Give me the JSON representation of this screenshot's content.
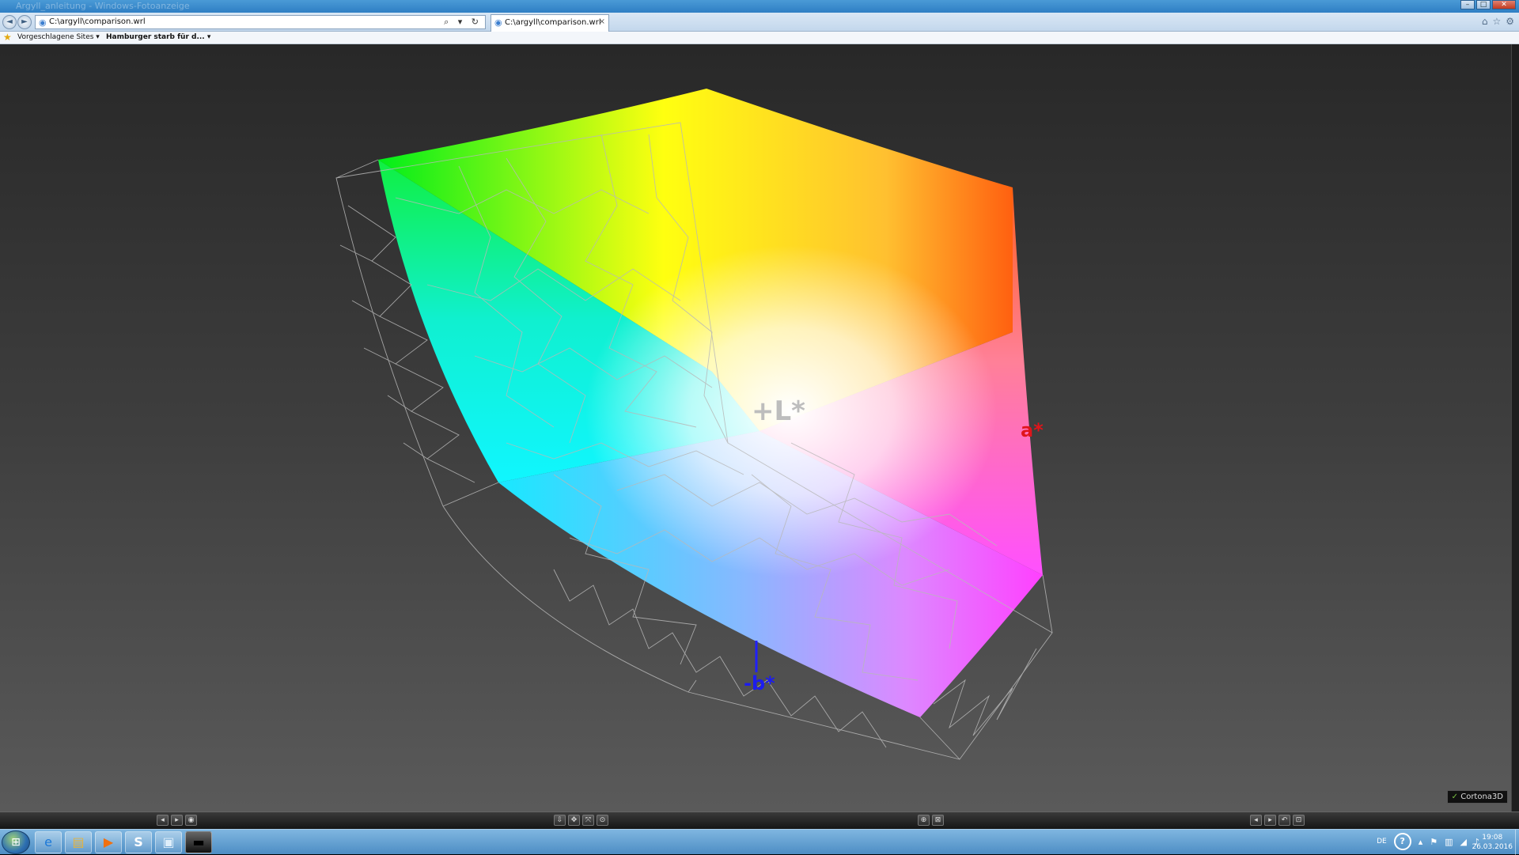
{
  "window": {
    "ghost_title": "Argyll_anleitung - Windows-Fotoanzeige",
    "min": "–",
    "max": "□",
    "close": "✕"
  },
  "nav": {
    "back_icon": "◄",
    "forward_icon": "►",
    "address": "C:\\argyll\\comparison.wrl",
    "address_tools": "⌕ ▾ ↻",
    "tab_label": "C:\\argyll\\comparison.wrl",
    "tab_close": "×",
    "tool_icons": [
      "⌂",
      "☆",
      "⚙"
    ]
  },
  "favorites": {
    "star": "★",
    "suggested_sites": "Vorgeschlagene Sites ▾",
    "news_item": "Hamburger starb für d... ▾"
  },
  "viewer": {
    "axis_L": "+L*",
    "axis_a": "a*",
    "axis_b": "-b*",
    "badge_brand": "Cortona3D",
    "colors": {
      "axis_L": "#bdbdbd",
      "axis_a": "#e0141a",
      "axis_b": "#1c1cf0"
    }
  },
  "controls": {
    "left": [
      "◂",
      "▸",
      "◉"
    ],
    "center": [
      "⇩",
      "✥",
      "⤧",
      "⊙"
    ],
    "mid_right": [
      "⊕",
      "⊠"
    ],
    "right": [
      "◂",
      "▸",
      "↶",
      "⊡"
    ]
  },
  "taskbar": {
    "start": "⊞",
    "apps": [
      {
        "icon": "e",
        "name": "internet-explorer"
      },
      {
        "icon": "▤",
        "name": "explorer"
      },
      {
        "icon": "▶",
        "name": "media-player"
      },
      {
        "icon": "S",
        "name": "skype"
      },
      {
        "icon": "▣",
        "name": "photo-viewer"
      },
      {
        "icon": "▬",
        "name": "command-prompt"
      }
    ],
    "tray_lang": "DE",
    "tray_help": "?",
    "tray_icons": [
      "▴",
      "⚑",
      "▥",
      "◢",
      "♪"
    ],
    "time": "19:08",
    "date": "26.03.2016"
  }
}
